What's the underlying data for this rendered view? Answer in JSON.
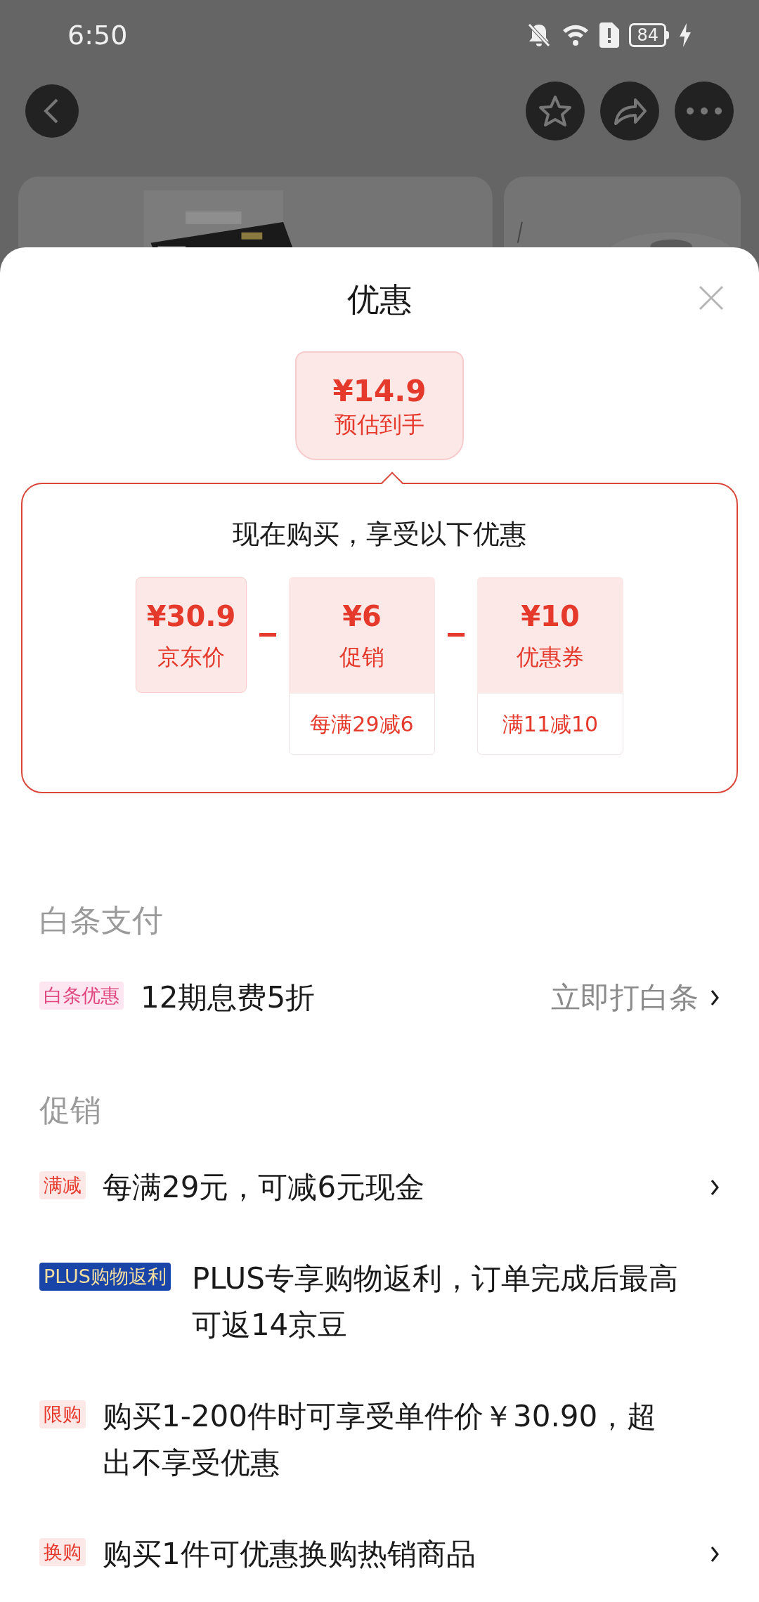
{
  "status_bar": {
    "time": "6:50",
    "battery": "84"
  },
  "sheet": {
    "title": "优惠"
  },
  "estimate": {
    "price": "¥14.9",
    "label": "预估到手"
  },
  "breakdown": {
    "heading": "现在购买，享受以下优惠",
    "items": [
      {
        "price": "¥30.9",
        "label": "京东价"
      },
      {
        "price": "¥6",
        "label": "促销",
        "note": "每满29减6"
      },
      {
        "price": "¥10",
        "label": "优惠券",
        "note": "满11减10"
      }
    ]
  },
  "sections": [
    {
      "title": "白条支付",
      "rows": [
        {
          "tag": "白条优惠",
          "kind": "baitiao",
          "text": "12期息费5折",
          "action": "立即打白条",
          "arrow": true
        }
      ]
    },
    {
      "title": "促销",
      "rows": [
        {
          "tag": "满减",
          "kind": "promo",
          "text": "每满29元，可减6元现金",
          "arrow": true
        },
        {
          "tag": "PLUS购物返利",
          "kind": "plus",
          "text": "PLUS专享购物返利，订单完成后最高可返14京豆",
          "arrow": false
        },
        {
          "tag": "限购",
          "kind": "promo",
          "text": "购买1-200件时可享受单件价￥30.90，超出不享受优惠",
          "arrow": false
        },
        {
          "tag": "换购",
          "kind": "promo",
          "text": "购买1件可优惠换购热销商品",
          "arrow": true
        }
      ]
    }
  ]
}
